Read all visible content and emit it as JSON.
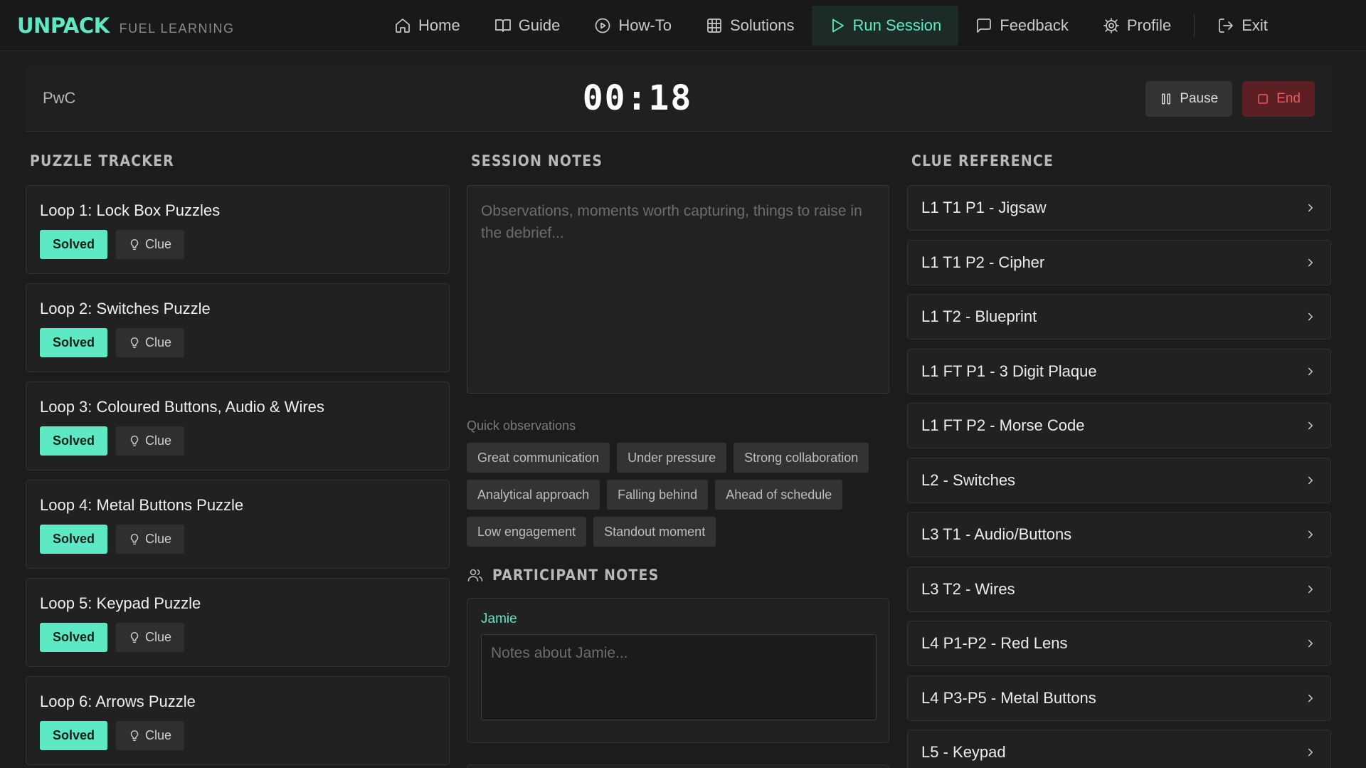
{
  "brand": {
    "name": "UNPACK",
    "subtitle": "FUEL LEARNING"
  },
  "nav": {
    "items": [
      {
        "label": "Home",
        "icon": "home-icon"
      },
      {
        "label": "Guide",
        "icon": "book-icon"
      },
      {
        "label": "How-To",
        "icon": "play-circle-icon"
      },
      {
        "label": "Solutions",
        "icon": "grid-icon"
      },
      {
        "label": "Run Session",
        "icon": "play-icon",
        "active": true
      },
      {
        "label": "Feedback",
        "icon": "message-icon"
      },
      {
        "label": "Profile",
        "icon": "gear-icon"
      }
    ],
    "exit_label": "Exit"
  },
  "session": {
    "client": "PwC",
    "timer": "00:18",
    "pause_label": "Pause",
    "end_label": "End"
  },
  "tracker": {
    "title": "PUZZLE TRACKER",
    "solved_label": "Solved",
    "clue_label": "Clue",
    "puzzles": [
      {
        "title": "Loop 1: Lock Box Puzzles"
      },
      {
        "title": "Loop 2: Switches Puzzle"
      },
      {
        "title": "Loop 3: Coloured Buttons, Audio & Wires"
      },
      {
        "title": "Loop 4: Metal Buttons Puzzle"
      },
      {
        "title": "Loop 5: Keypad Puzzle"
      },
      {
        "title": "Loop 6: Arrows Puzzle"
      }
    ]
  },
  "notes": {
    "title": "SESSION NOTES",
    "placeholder": "Observations, moments worth capturing, things to raise in the debrief...",
    "value": "",
    "quick_label": "Quick observations",
    "chips": [
      "Great communication",
      "Under pressure",
      "Strong collaboration",
      "Analytical approach",
      "Falling behind",
      "Ahead of schedule",
      "Low engagement",
      "Standout moment"
    ]
  },
  "participants": {
    "title": "PARTICIPANT NOTES",
    "items": [
      {
        "name": "Jamie",
        "placeholder": "Notes about Jamie...",
        "value": ""
      }
    ]
  },
  "clues": {
    "title": "CLUE REFERENCE",
    "items": [
      "L1 T1 P1 - Jigsaw",
      "L1 T1 P2 - Cipher",
      "L1 T2 - Blueprint",
      "L1 FT P1 - 3 Digit Plaque",
      "L1 FT P2 - Morse Code",
      "L2 - Switches",
      "L3 T1 - Audio/Buttons",
      "L3 T2 - Wires",
      "L4 P1-P2 - Red Lens",
      "L4 P3-P5 - Metal Buttons",
      "L5 - Keypad"
    ]
  },
  "colors": {
    "accent": "#5ee9c5",
    "background": "#1c1c1c",
    "danger": "#f05a5f"
  }
}
